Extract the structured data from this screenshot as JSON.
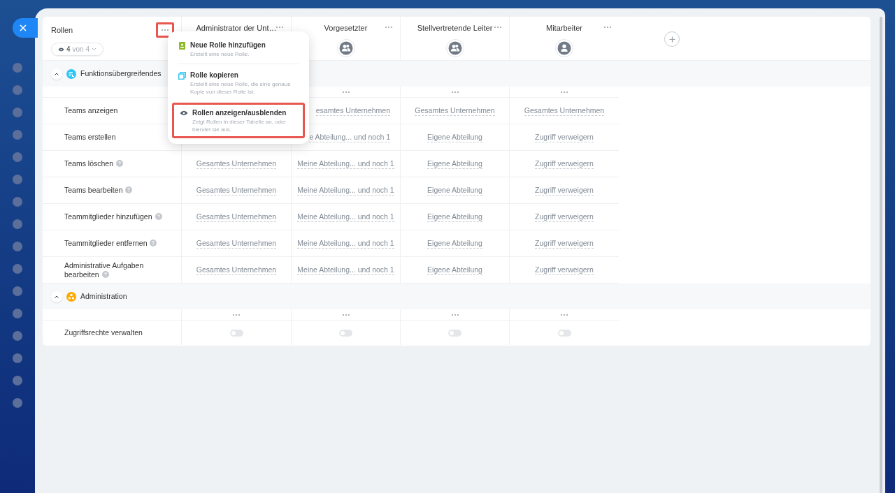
{
  "roles_header": {
    "title": "Rollen",
    "menu_button_highlighted": true,
    "filter": {
      "count": "4",
      "of": "von 4"
    }
  },
  "roles": [
    {
      "name": "Administrator der Unt…",
      "kind": "none"
    },
    {
      "name": "Vorgesetzter",
      "kind": "group"
    },
    {
      "name": "Stellvertretende Leiter",
      "kind": "group"
    },
    {
      "name": "Mitarbeiter",
      "kind": "person"
    }
  ],
  "menu": {
    "items": [
      {
        "kind": "add",
        "title": "Neue Rolle hinzufügen",
        "description": "Erstellt eine neue Rolle.",
        "highlighted": false
      },
      {
        "kind": "copy",
        "title": "Rolle kopieren",
        "description": "Erstellt eine neue Rolle, die eine genaue Kopie von dieser Rolle ist.",
        "highlighted": false
      },
      {
        "kind": "visibility",
        "title": "Rollen anzeigen/ausblenden",
        "description": "Zeigt Rollen in dieser Tabelle an, oder blendet sie aus.",
        "highlighted": true
      }
    ]
  },
  "groups": [
    {
      "title": "Funktionsübergreifendes",
      "kind": "teams",
      "expanded": true,
      "rows": [
        {
          "kind": "scope",
          "label": "Teams anzeigen",
          "help": false,
          "values": [
            "esamtes Unternehmen",
            "Gesamtes Unternehmen",
            "Gesamtes Unternehmen"
          ]
        },
        {
          "kind": "scope",
          "label": "Teams erstellen",
          "help": false,
          "values": [
            "e Abteilung... und noch 1",
            "Eigene Abteilung",
            "Zugriff verweigern"
          ]
        },
        {
          "kind": "scope",
          "label": "Teams löschen",
          "help": true,
          "values": [
            "Gesamtes Unternehmen",
            "Meine Abteilung... und noch 1",
            "Eigene Abteilung",
            "Zugriff verweigern"
          ]
        },
        {
          "kind": "scope",
          "label": "Teams bearbeiten",
          "help": true,
          "values": [
            "Gesamtes Unternehmen",
            "Meine Abteilung... und noch 1",
            "Eigene Abteilung",
            "Zugriff verweigern"
          ]
        },
        {
          "kind": "scope",
          "label": "Teammitglieder hinzufügen",
          "help": true,
          "values": [
            "Gesamtes Unternehmen",
            "Meine Abteilung... und noch 1",
            "Eigene Abteilung",
            "Zugriff verweigern"
          ]
        },
        {
          "kind": "scope",
          "label": "Teammitglieder entfernen",
          "help": true,
          "values": [
            "Gesamtes Unternehmen",
            "Meine Abteilung... und noch 1",
            "Eigene Abteilung",
            "Zugriff verweigern"
          ]
        },
        {
          "kind": "scope",
          "label": "Administrative Aufgaben bearbeiten",
          "help": true,
          "values": [
            "Gesamtes Unternehmen",
            "Meine Abteilung... und noch 1",
            "Eigene Abteilung",
            "Zugriff verweigern"
          ]
        }
      ]
    },
    {
      "title": "Administration",
      "kind": "admin",
      "expanded": true,
      "rows": [
        {
          "kind": "toggle",
          "label": "Zugriffsrechte verwalten",
          "help": false,
          "toggles": [
            false,
            false,
            false,
            false
          ]
        }
      ]
    }
  ]
}
